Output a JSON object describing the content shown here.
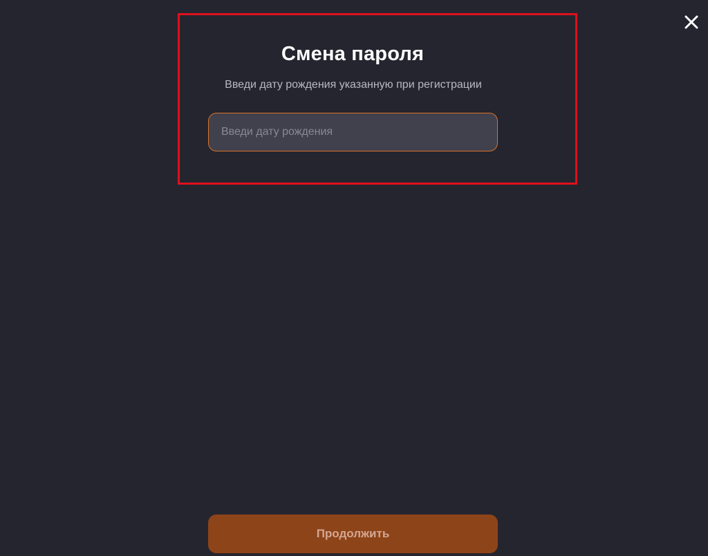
{
  "header": {
    "close_icon": "close-icon"
  },
  "form": {
    "title": "Смена пароля",
    "subtitle": "Введи дату рождения указанную при регистрации",
    "birthdate_placeholder": "Введи дату рождения",
    "birthdate_value": ""
  },
  "footer": {
    "continue_label": "Продолжить"
  },
  "colors": {
    "background": "#25252f",
    "input_background": "#41404d",
    "input_border": "#d9722a",
    "button_background": "#8e4419",
    "highlight": "#e0101c"
  }
}
